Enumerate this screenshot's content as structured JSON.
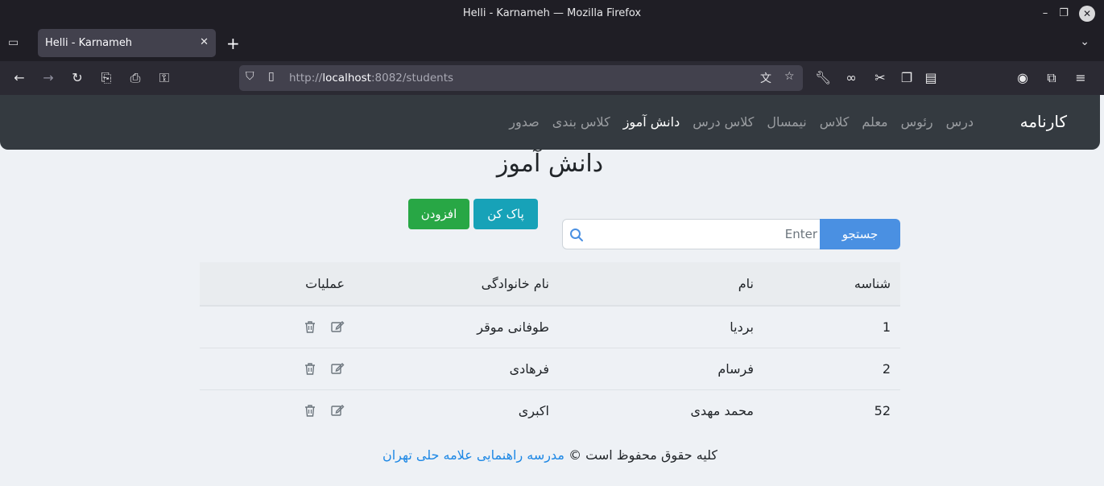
{
  "window": {
    "title": "Helli - Karnameh — Mozilla Firefox"
  },
  "tab": {
    "title": "Helli - Karnameh"
  },
  "urlbar": {
    "prefix": "http://",
    "host": "localhost",
    "rest": ":8082/students"
  },
  "site": {
    "brand": "کارنامه",
    "menu": [
      {
        "label": "درس",
        "active": false
      },
      {
        "label": "رئوس",
        "active": false
      },
      {
        "label": "معلم",
        "active": false
      },
      {
        "label": "کلاس",
        "active": false
      },
      {
        "label": "نیمسال",
        "active": false
      },
      {
        "label": "کلاس درس",
        "active": false
      },
      {
        "label": "دانش آموز",
        "active": true
      },
      {
        "label": "کلاس بندی",
        "active": false
      },
      {
        "label": "صدور",
        "active": false
      }
    ]
  },
  "page": {
    "heading": "دانش آموز",
    "buttons": {
      "clear": "پاک کن",
      "add": "افزودن"
    },
    "search": {
      "placeholder": "Enter",
      "button": "جستجو"
    }
  },
  "table": {
    "headers": {
      "id": "شناسه",
      "name": "نام",
      "family": "نام خانوادگی",
      "ops": "عملیات"
    },
    "rows": [
      {
        "id": "1",
        "name": "بردیا",
        "family": "طوفانی موقر"
      },
      {
        "id": "2",
        "name": "فرسام",
        "family": "فرهادی"
      },
      {
        "id": "52",
        "name": "محمد مهدی",
        "family": "اکبری"
      }
    ]
  },
  "footer": {
    "text": "کلیه حقوق محفوظ است ©",
    "link": "مدرسه راهنمایی علامه حلی تهران"
  },
  "colors": {
    "navbar": "#343a40",
    "clear": "#17a2b8",
    "add": "#28a745",
    "search": "#4a90e2",
    "link": "#1e88e5"
  }
}
